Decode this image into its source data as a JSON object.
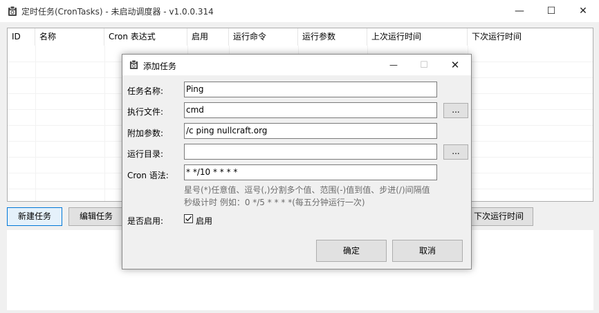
{
  "window": {
    "title": "定时任务(CronTasks) - 未启动调度器 - v1.0.0.314",
    "minimize": "—",
    "maximize": "☐",
    "close": "✕"
  },
  "table": {
    "columns": [
      "ID",
      "名称",
      "Cron 表达式",
      "启用",
      "运行命令",
      "运行参数",
      "上次运行时间",
      "下次运行时间"
    ]
  },
  "toolbar": {
    "new_task": "新建任务",
    "edit_task": "编辑任务",
    "next_run": "下次运行时间"
  },
  "dialog": {
    "title": "添加任务",
    "minimize": "—",
    "maximize": "☐",
    "close": "✕",
    "fields": {
      "name_label": "任务名称:",
      "name_value": "Ping",
      "exec_label": "执行文件:",
      "exec_value": "cmd",
      "args_label": "附加参数:",
      "args_value": "/c ping nullcraft.org",
      "dir_label": "运行目录:",
      "dir_value": "",
      "cron_label": "Cron 语法:",
      "cron_value": "* */10 * * * *",
      "enabled_label": "是否启用:",
      "enabled_checkbox_label": "启用",
      "enabled_checked": true
    },
    "browse_label": "...",
    "hint_line1": "星号(*)任意值、逗号(,)分割多个值、范围(-)值到值、步进(/)间隔值",
    "hint_line2": "秒级计时 例如：0 */5 * * * *(每五分钟运行一次)",
    "ok_label": "确定",
    "cancel_label": "取消"
  },
  "colors": {
    "primary_border": "#0078d7",
    "window_bg": "#f0f0f0"
  }
}
